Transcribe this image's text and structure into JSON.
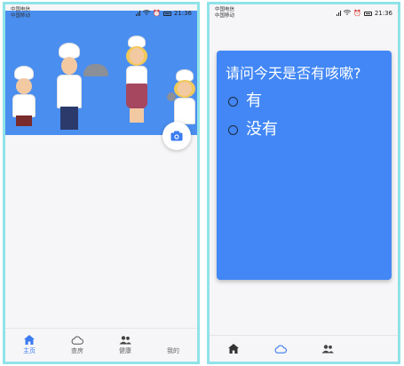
{
  "left_screen": {
    "status": {
      "carrier_1": "中国电信",
      "carrier_2": "中国移动",
      "time": "21:36"
    },
    "hero": {
      "illustration": "cartoon-chefs"
    },
    "camera_button": {
      "icon": "camera-icon"
    },
    "bottom_nav": [
      {
        "label": "主页",
        "icon": "home-icon",
        "active": true
      },
      {
        "label": "查房",
        "icon": "cloud-icon",
        "active": false
      },
      {
        "label": "健康",
        "icon": "people-icon",
        "active": false
      },
      {
        "label": "我的",
        "icon": "moon-icon",
        "active": false
      }
    ]
  },
  "right_screen": {
    "status": {
      "carrier_1": "中国电信",
      "carrier_2": "中国移动",
      "time": "21:36"
    },
    "question": "请问今天是否有咳嗽?",
    "options": [
      "有",
      "没有"
    ],
    "bottom_nav": [
      {
        "icon": "home-icon"
      },
      {
        "icon": "cloud-icon"
      },
      {
        "icon": "people-icon"
      },
      {
        "icon": "moon-icon"
      }
    ]
  },
  "colors": {
    "accent": "#3c7cf0",
    "card": "#4287f5",
    "frame": "#8fe3e8"
  }
}
